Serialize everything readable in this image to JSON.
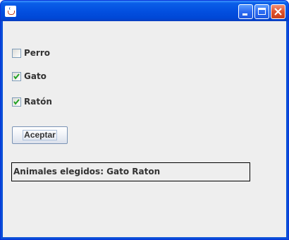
{
  "window": {
    "title": "",
    "icon": "java-cup-icon",
    "controls": {
      "minimize": "minimize-icon",
      "maximize": "maximize-icon",
      "close": "close-icon"
    },
    "colors": {
      "titlebar": "#0350e0",
      "client": "#eeeeee",
      "close_button": "#e0522c"
    }
  },
  "checkboxes": [
    {
      "label": "Perro",
      "checked": false
    },
    {
      "label": "Gato",
      "checked": true
    },
    {
      "label": "Ratón",
      "checked": true
    }
  ],
  "accept_button": {
    "label": "Aceptar"
  },
  "result": {
    "text": "Animales elegidos: Gato Raton"
  }
}
